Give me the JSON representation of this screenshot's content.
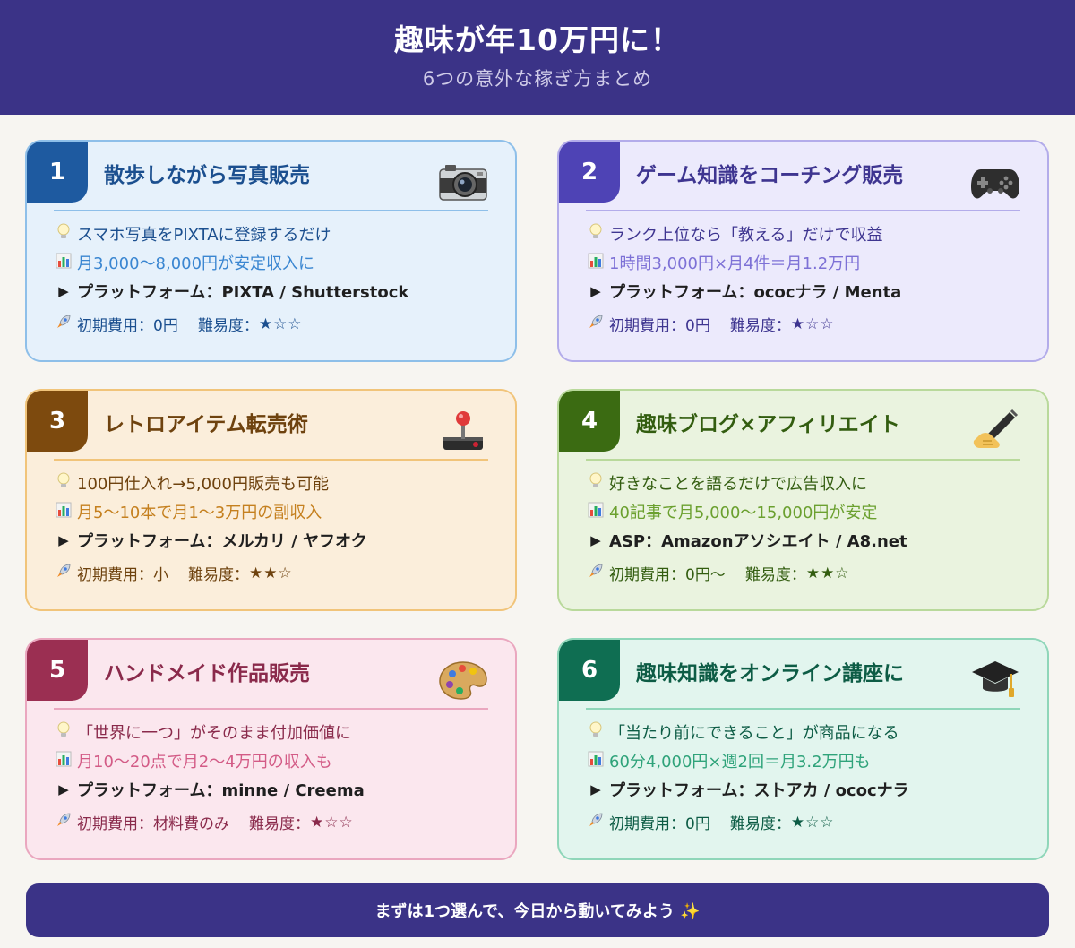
{
  "header": {
    "title": "趣味が年10万円に！",
    "subtitle": "6つの意外な稼ぎ方まとめ"
  },
  "cards": [
    {
      "number": "1",
      "title": "散歩しながら写真販売",
      "icon": "camera-icon",
      "tip": "スマホ写真をPIXTAに登録するだけ",
      "income": "月3,000〜8,000円が安定収入に",
      "platform": "プラットフォーム：PIXTA / Shutterstock",
      "cost": "初期費用：0円",
      "difficulty_label": "難易度：",
      "difficulty_stars": "★☆☆",
      "colors": {
        "bg": "#e6f1fb",
        "border": "#8ebfe9",
        "badge": "#1e5aa0",
        "title": "#1b4f8f",
        "text": "#1b4f8f",
        "accent": "#3a86d1"
      }
    },
    {
      "number": "2",
      "title": "ゲーム知識をコーチング販売",
      "icon": "gamepad-icon",
      "tip": "ランク上位なら「教える」だけで収益",
      "income": "1時間3,000円×月4件＝月1.2万円",
      "platform": "プラットフォーム：ococナラ / Menta",
      "cost": "初期費用：0円",
      "difficulty_label": "難易度：",
      "difficulty_stars": "★☆☆",
      "colors": {
        "bg": "#eceafc",
        "border": "#b3acea",
        "badge": "#4e43b5",
        "title": "#3e3590",
        "text": "#3e3590",
        "accent": "#7d71d6"
      }
    },
    {
      "number": "3",
      "title": "レトロアイテム転売術",
      "icon": "joystick-icon",
      "tip": "100円仕入れ→5,000円販売も可能",
      "income": "月5〜10本で月1〜3万円の副収入",
      "platform": "プラットフォーム：メルカリ / ヤフオク",
      "cost": "初期費用：小",
      "difficulty_label": "難易度：",
      "difficulty_stars": "★★☆",
      "colors": {
        "bg": "#fbeedb",
        "border": "#f1c47a",
        "badge": "#7d4a0e",
        "title": "#6e420e",
        "text": "#6e420e",
        "accent": "#c5801f"
      }
    },
    {
      "number": "4",
      "title": "趣味ブログ×アフィリエイト",
      "icon": "writing-hand-icon",
      "tip": "好きなことを語るだけで広告収入に",
      "income": "40記事で月5,000〜15,000円が安定",
      "platform": "ASP：Amazonアソシエイト / A8.net",
      "cost": "初期費用：0円〜",
      "difficulty_label": "難易度：",
      "difficulty_stars": "★★☆",
      "colors": {
        "bg": "#eaf3df",
        "border": "#b9d99b",
        "badge": "#3b6b12",
        "title": "#335d10",
        "text": "#335d10",
        "accent": "#6ba02f"
      }
    },
    {
      "number": "5",
      "title": "ハンドメイド作品販売",
      "icon": "palette-icon",
      "tip": "「世界に一つ」がそのまま付加価値に",
      "income": "月10〜20点で月2〜4万円の収入も",
      "platform": "プラットフォーム：minne / Creema",
      "cost": "初期費用：材料費のみ",
      "difficulty_label": "難易度：",
      "difficulty_stars": "★☆☆",
      "colors": {
        "bg": "#fbe7ee",
        "border": "#eaa7bf",
        "badge": "#9b2f52",
        "title": "#8a2a4b",
        "text": "#8a2a4b",
        "accent": "#d35b86"
      }
    },
    {
      "number": "6",
      "title": "趣味知識をオンライン講座に",
      "icon": "graduation-cap-icon",
      "tip": "「当たり前にできること」が商品になる",
      "income": "60分4,000円×週2回＝月3.2万円も",
      "platform": "プラットフォーム：ストアカ / ococナラ",
      "cost": "初期費用：0円",
      "difficulty_label": "難易度：",
      "difficulty_stars": "★☆☆",
      "colors": {
        "bg": "#e2f5ee",
        "border": "#8fd6b9",
        "badge": "#0f6e52",
        "title": "#0d5c45",
        "text": "#0d5c45",
        "accent": "#2fa37a"
      }
    }
  ],
  "footer": {
    "text": "まずは1つ選んで、今日から動いてみよう ✨"
  }
}
